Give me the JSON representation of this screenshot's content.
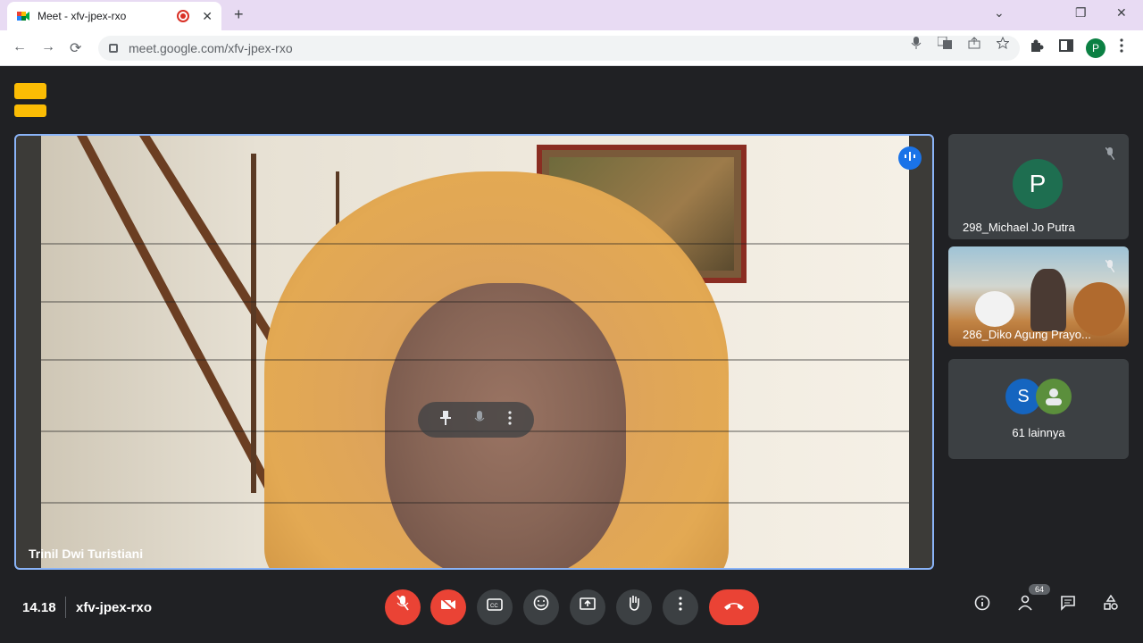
{
  "browser": {
    "tab_title": "Meet - xfv-jpex-rxo",
    "url": "meet.google.com/xfv-jpex-rxo",
    "profile_initial": "P",
    "icons": {
      "close": "✕",
      "new_tab": "+",
      "back": "←",
      "forward": "→",
      "reload": "⟳",
      "minimize": "⌄",
      "restore": "❐",
      "window_close": "✕"
    }
  },
  "meeting": {
    "time": "14.18",
    "code": "xfv-jpex-rxo",
    "main_participant": "Trinil Dwi Turistiani",
    "sidebar": [
      {
        "name": "298_Michael Jo Putra",
        "initial": "P"
      },
      {
        "name": "286_Diko Agung Prayo..."
      },
      {
        "others_label": "61 lainnya",
        "initial": "S"
      }
    ],
    "participant_count": "64"
  },
  "colors": {
    "accent": "#8ab4f8",
    "danger": "#ea4335",
    "surface": "#3c4043",
    "background": "#202124"
  }
}
